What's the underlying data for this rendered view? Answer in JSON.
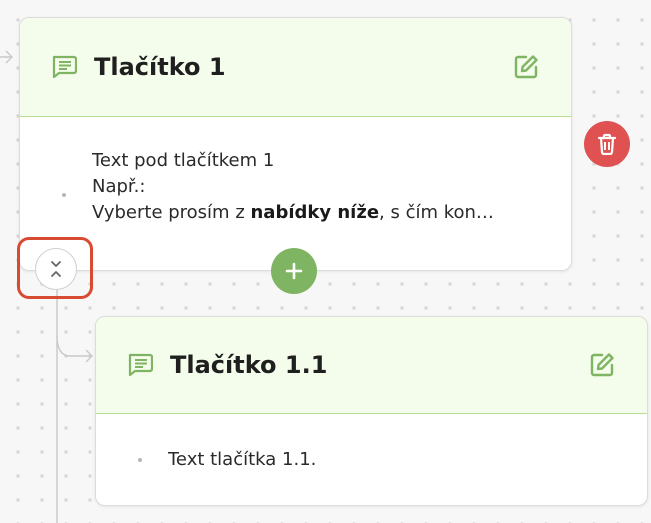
{
  "colors": {
    "accent_green": "#7fb562",
    "header_green": "#f4fceb",
    "delete_red": "#e05252",
    "highlight_red": "#d94a33"
  },
  "card1": {
    "title": "Tlačítko 1",
    "line1": "Text pod tlačítkem 1",
    "line2": "Např.:",
    "line3_pre": "Vyberte prosím z ",
    "line3_bold": "nabídky níže",
    "line3_post": ", s čím kon…",
    "chat_icon": "chat-icon",
    "edit_icon": "edit-icon"
  },
  "card2": {
    "title": "Tlačítko 1.1",
    "line1": "Text tlačítka 1.1.",
    "chat_icon": "chat-icon",
    "edit_icon": "edit-icon"
  },
  "controls": {
    "delete_icon": "trash-icon",
    "add_icon": "plus-icon",
    "collapse_icon": "collapse-chevrons-icon"
  }
}
